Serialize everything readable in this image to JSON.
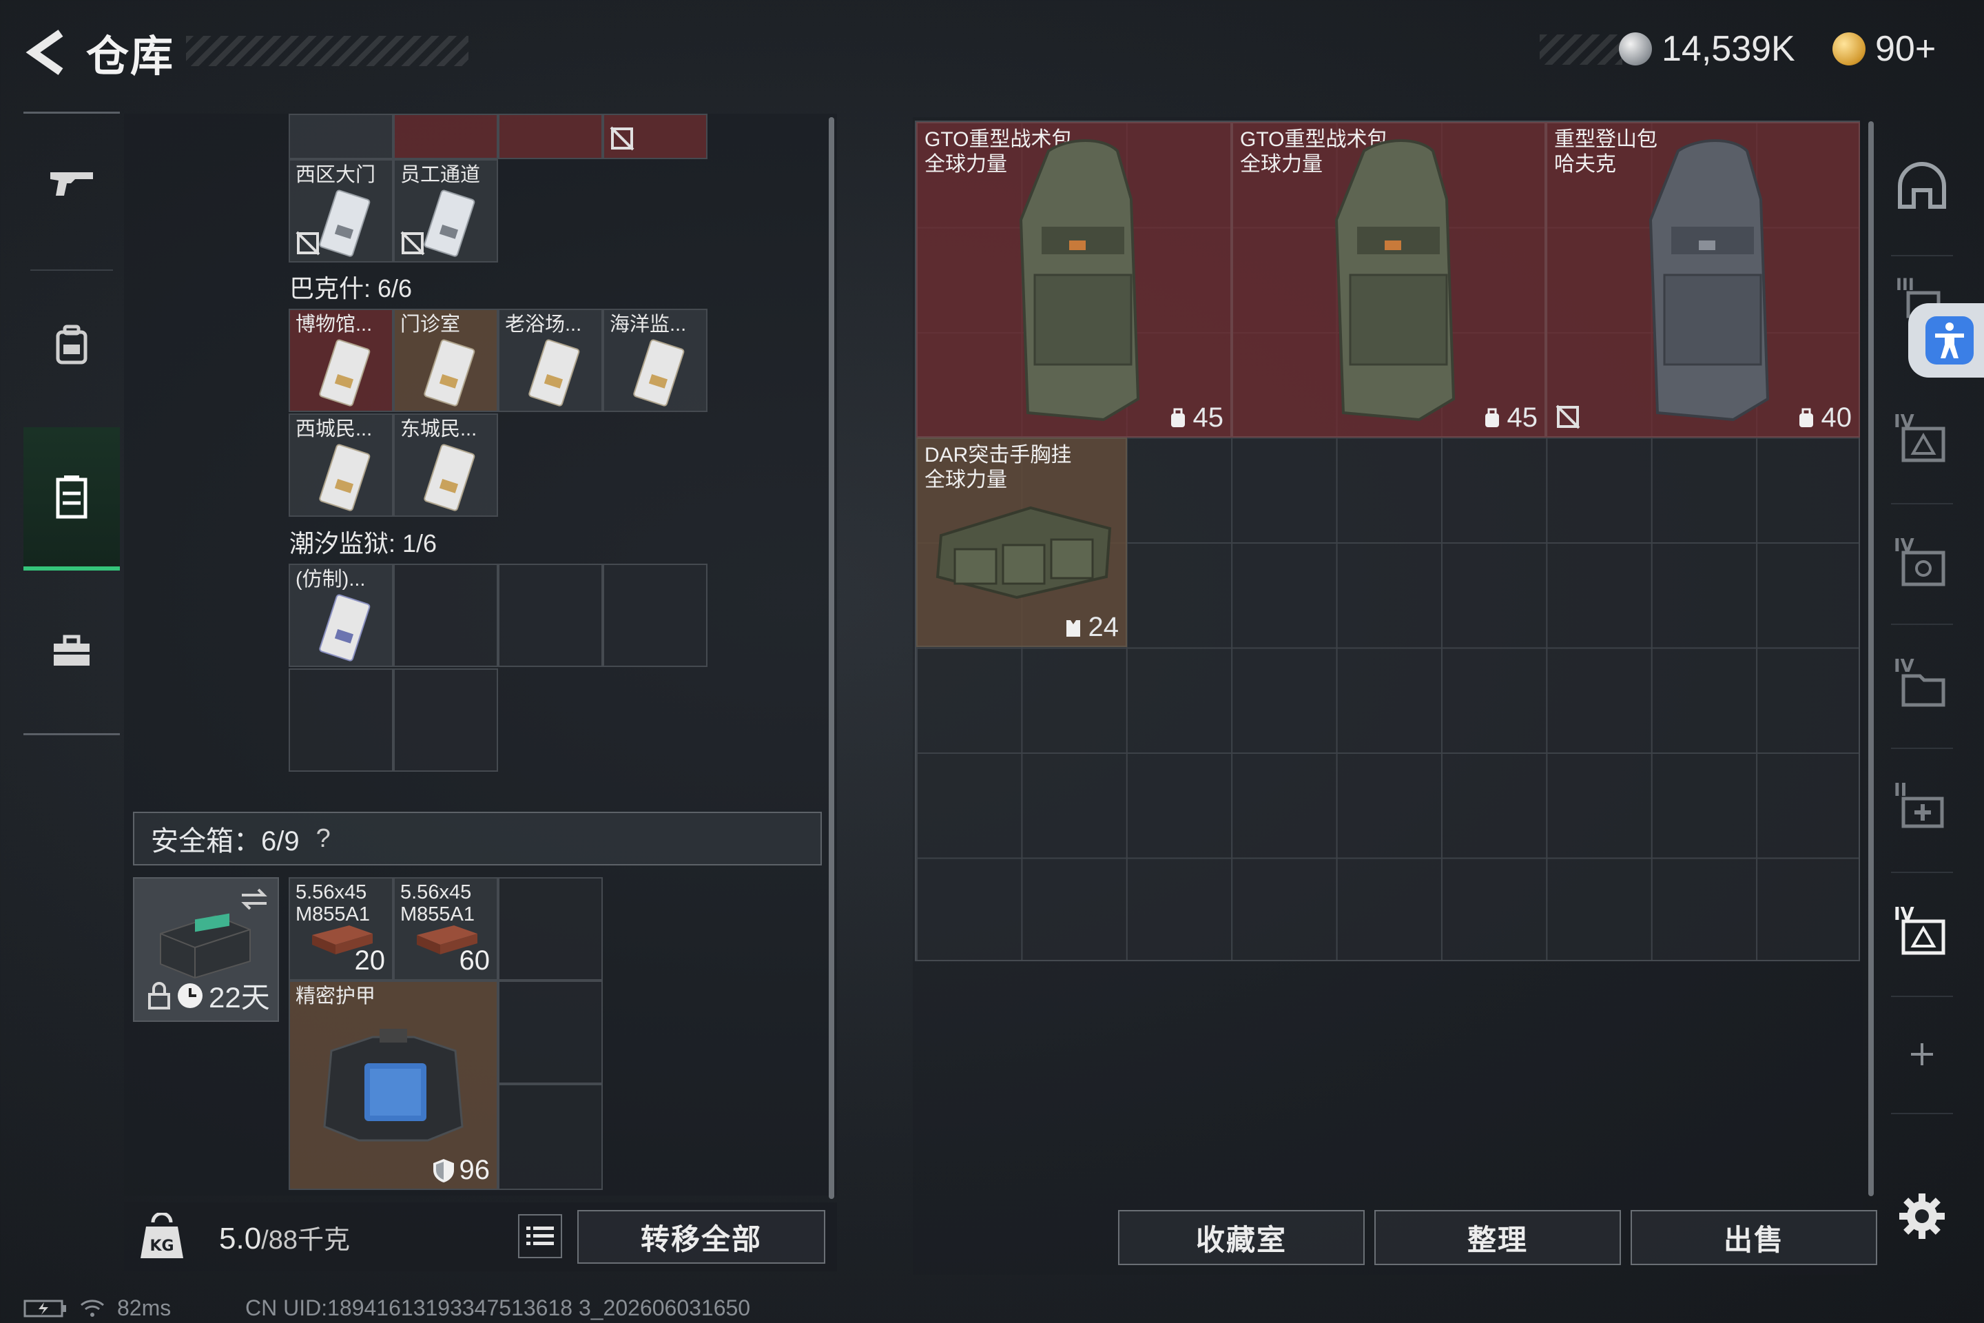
{
  "header": {
    "title": "仓库",
    "currency_silver": "14,539K",
    "currency_gold": "90+"
  },
  "left_nav": [
    {
      "name": "weapon",
      "icon": "gun-icon"
    },
    {
      "name": "backpack",
      "icon": "backpack-icon"
    },
    {
      "name": "storage",
      "icon": "locker-icon",
      "active": true
    },
    {
      "name": "toolbox",
      "icon": "briefcase-icon"
    }
  ],
  "storage": {
    "top_row_labels": [
      "西区大门",
      "员工通道"
    ],
    "group_bakshi": {
      "title": "巴克什: 6/6",
      "cards": [
        "博物馆...",
        "门诊室",
        "老浴场...",
        "海洋监...",
        "西城民...",
        "东城民..."
      ]
    },
    "group_prison": {
      "title": "潮汐监狱: 1/6",
      "cards": [
        "(仿制)..."
      ]
    }
  },
  "safebox": {
    "title": "安全箱：6/9",
    "help": "?",
    "time_left": "22天",
    "ammo": [
      {
        "label_line1": "5.56x45",
        "label_line2": "M855A1",
        "count": "20"
      },
      {
        "label_line1": "5.56x45",
        "label_line2": "M855A1",
        "count": "60"
      }
    ],
    "armor": {
      "label": "精密护甲",
      "count": "96"
    }
  },
  "bottom_left": {
    "weight_value": "5.0",
    "weight_max": "/88千克",
    "transfer_all": "转移全部"
  },
  "right_items": [
    {
      "line1": "GTO重型战术包",
      "line2": "全球力量",
      "count": "45"
    },
    {
      "line1": "GTO重型战术包",
      "line2": "全球力量",
      "count": "45"
    },
    {
      "line1": "重型登山包",
      "line2": "哈夫克",
      "count": "40"
    },
    {
      "line1": "DAR突击手胸挂",
      "line2": "全球力量",
      "count": "24"
    }
  ],
  "bottom_right": {
    "collection": "收藏室",
    "organize": "整理",
    "sell": "出售"
  },
  "status": {
    "ping": "82ms",
    "uid": "CN UID:18941613193347513618 3_202606031650"
  },
  "colors": {
    "accent_green": "#35c57b",
    "item_red": "#702d32",
    "item_brown": "#604a3a",
    "access_blue": "#3b7fe6"
  }
}
